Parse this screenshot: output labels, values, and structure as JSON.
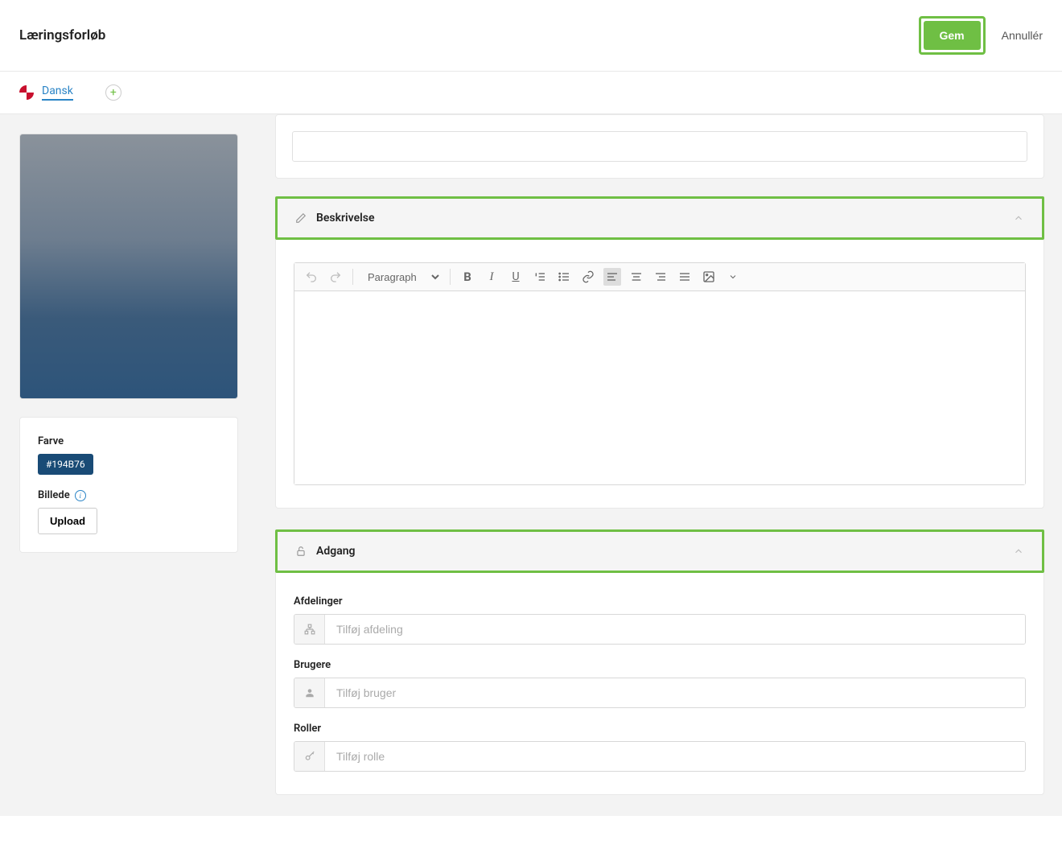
{
  "header": {
    "title": "Læringsforløb",
    "save_label": "Gem",
    "cancel_label": "Annullér"
  },
  "language": {
    "current": "Dansk"
  },
  "sidebar": {
    "color_label": "Farve",
    "color_value": "#194B76",
    "image_label": "Billede",
    "upload_label": "Upload"
  },
  "editor": {
    "format_label": "Paragraph"
  },
  "sections": {
    "description": {
      "title": "Beskrivelse"
    },
    "access": {
      "title": "Adgang",
      "departments_label": "Afdelinger",
      "departments_placeholder": "Tilføj afdeling",
      "users_label": "Brugere",
      "users_placeholder": "Tilføj bruger",
      "roles_label": "Roller",
      "roles_placeholder": "Tilføj rolle"
    }
  }
}
